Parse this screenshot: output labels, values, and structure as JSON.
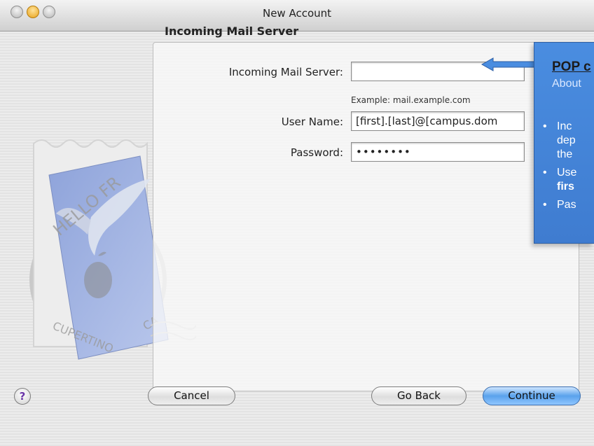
{
  "window": {
    "title": "New Account"
  },
  "panel": {
    "heading": "Incoming Mail Server",
    "fields": {
      "server": {
        "label": "Incoming Mail Server:",
        "value": "",
        "example": "Example: mail.example.com"
      },
      "username": {
        "label": "User Name:",
        "value": "[first].[last]@[campus.dom"
      },
      "password": {
        "label": "Password:",
        "value": "••••••••"
      }
    }
  },
  "stamp": {
    "text_top": "HELLO FR",
    "text_bottom": "CUPERTINO",
    "text_side": "CA"
  },
  "buttons": {
    "help": "?",
    "cancel": "Cancel",
    "go_back": "Go Back",
    "continue": "Continue"
  },
  "callout": {
    "title": "POP c",
    "subtitle": "About",
    "items": [
      "Inc",
      "dep",
      "the",
      "Use",
      "firs",
      "Pas"
    ]
  },
  "colors": {
    "callout": "#4a8de0",
    "primary_button": "#5aa2ec",
    "help_icon": "#6a35a8"
  },
  "icons": {
    "window": [
      "close-icon",
      "minimize-icon",
      "zoom-icon"
    ],
    "help": "question-icon",
    "callout_arrow": "left-arrow-icon"
  }
}
